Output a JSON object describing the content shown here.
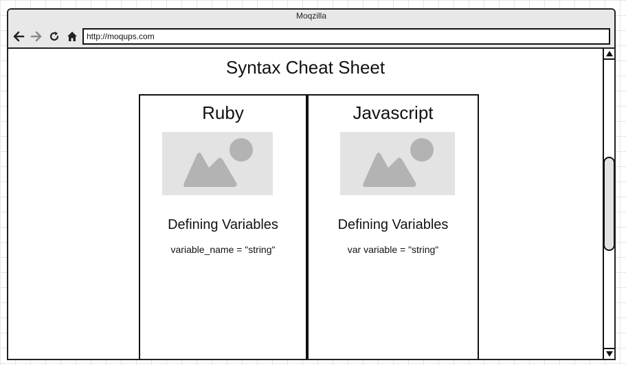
{
  "window": {
    "title": "Moqzilla"
  },
  "toolbar": {
    "back_icon": "arrow-left-icon",
    "forward_icon": "arrow-right-icon",
    "reload_icon": "reload-icon",
    "home_icon": "home-icon",
    "url": "http://moqups.com"
  },
  "page": {
    "title": "Syntax Cheat Sheet",
    "cards": [
      {
        "title": "Ruby",
        "image_icon": "image-placeholder-icon",
        "section_heading": "Defining Variables",
        "code": "variable_name = \"string\""
      },
      {
        "title": "Javascript",
        "image_icon": "image-placeholder-icon",
        "section_heading": "Defining Variables",
        "code": "var variable = \"string\""
      }
    ]
  },
  "scrollbar": {
    "up_icon": "triangle-up-icon",
    "down_icon": "triangle-down-icon"
  },
  "colors": {
    "placeholder_bg": "#e3e3e3",
    "placeholder_shape": "#b3b3b3",
    "border": "#111111",
    "titlebar_bg": "#e8e8e8"
  }
}
